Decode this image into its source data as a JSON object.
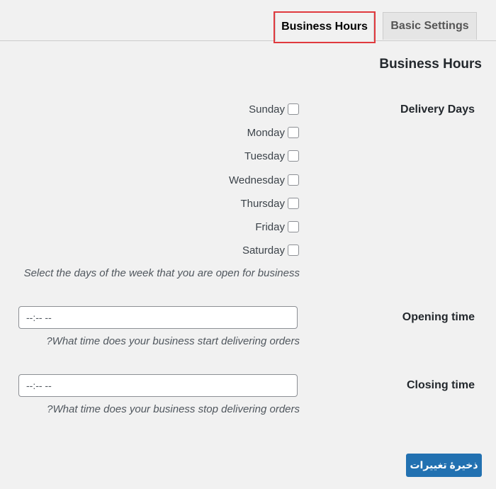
{
  "tabs": [
    {
      "label": "Business Hours",
      "active": true
    },
    {
      "label": "Basic Settings",
      "active": false
    }
  ],
  "section_title": "Business Hours",
  "delivery_days": {
    "label": "Delivery Days",
    "days": [
      {
        "label": "Sunday",
        "checked": false
      },
      {
        "label": "Monday",
        "checked": false
      },
      {
        "label": "Tuesday",
        "checked": false
      },
      {
        "label": "Wednesday",
        "checked": false
      },
      {
        "label": "Thursday",
        "checked": false
      },
      {
        "label": "Friday",
        "checked": false
      },
      {
        "label": "Saturday",
        "checked": false
      }
    ],
    "description": "Select the days of the week that you are open for business"
  },
  "opening_time": {
    "label": "Opening time",
    "value": "--:-- --",
    "description": "?What time does your business start delivering orders"
  },
  "closing_time": {
    "label": "Closing time",
    "value": "--:-- --",
    "description": "?What time does your business stop delivering orders"
  },
  "save_button": {
    "label": "ذخيرهٔ تغييرات"
  },
  "colors": {
    "background": "#f1f1f1",
    "primary_button": "#2271b1",
    "highlight_border": "#e0393e"
  }
}
